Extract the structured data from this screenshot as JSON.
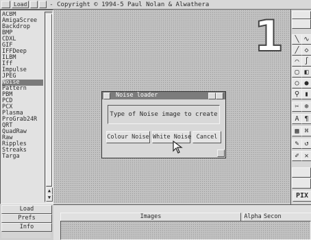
{
  "titlebar": {
    "load_label": "Load",
    "title": "- Copyright © 1994-5 Paul Nolan & Alwathera"
  },
  "formats": [
    "ACBM",
    "AmigaScree",
    "Backdrop",
    "BMP",
    "CDXL",
    "GIF",
    "IFFDeep",
    "ILBM",
    "Iff",
    "Impulse",
    "JPEG",
    "Noise",
    "Pattern",
    "PBM",
    "PCD",
    "PCX",
    "Plasma",
    "ProGrab24R",
    "QRT",
    "QuadRaw",
    "Raw",
    "Ripples",
    "Streaks",
    "Targa"
  ],
  "selected_format": "Noise",
  "left_buttons": {
    "load": "Load",
    "prefs": "Prefs",
    "info": "Info"
  },
  "canvas": {
    "big_number": "1"
  },
  "toolbox": {
    "pix_label": "PIX"
  },
  "dialog": {
    "title": "Noise loader",
    "message": "Type of Noise image to create",
    "buttons": {
      "colour": "Colour Noise",
      "white": "White Noise",
      "cancel": "Cancel"
    }
  },
  "bottom_panel": {
    "images_header": "Images",
    "alpha_header": "Alpha",
    "second_header": "Secon"
  },
  "colors": {
    "stipple": "#c2c2c2",
    "selection": "#7a7a7a",
    "dialog_title": "#7c7c7c"
  }
}
